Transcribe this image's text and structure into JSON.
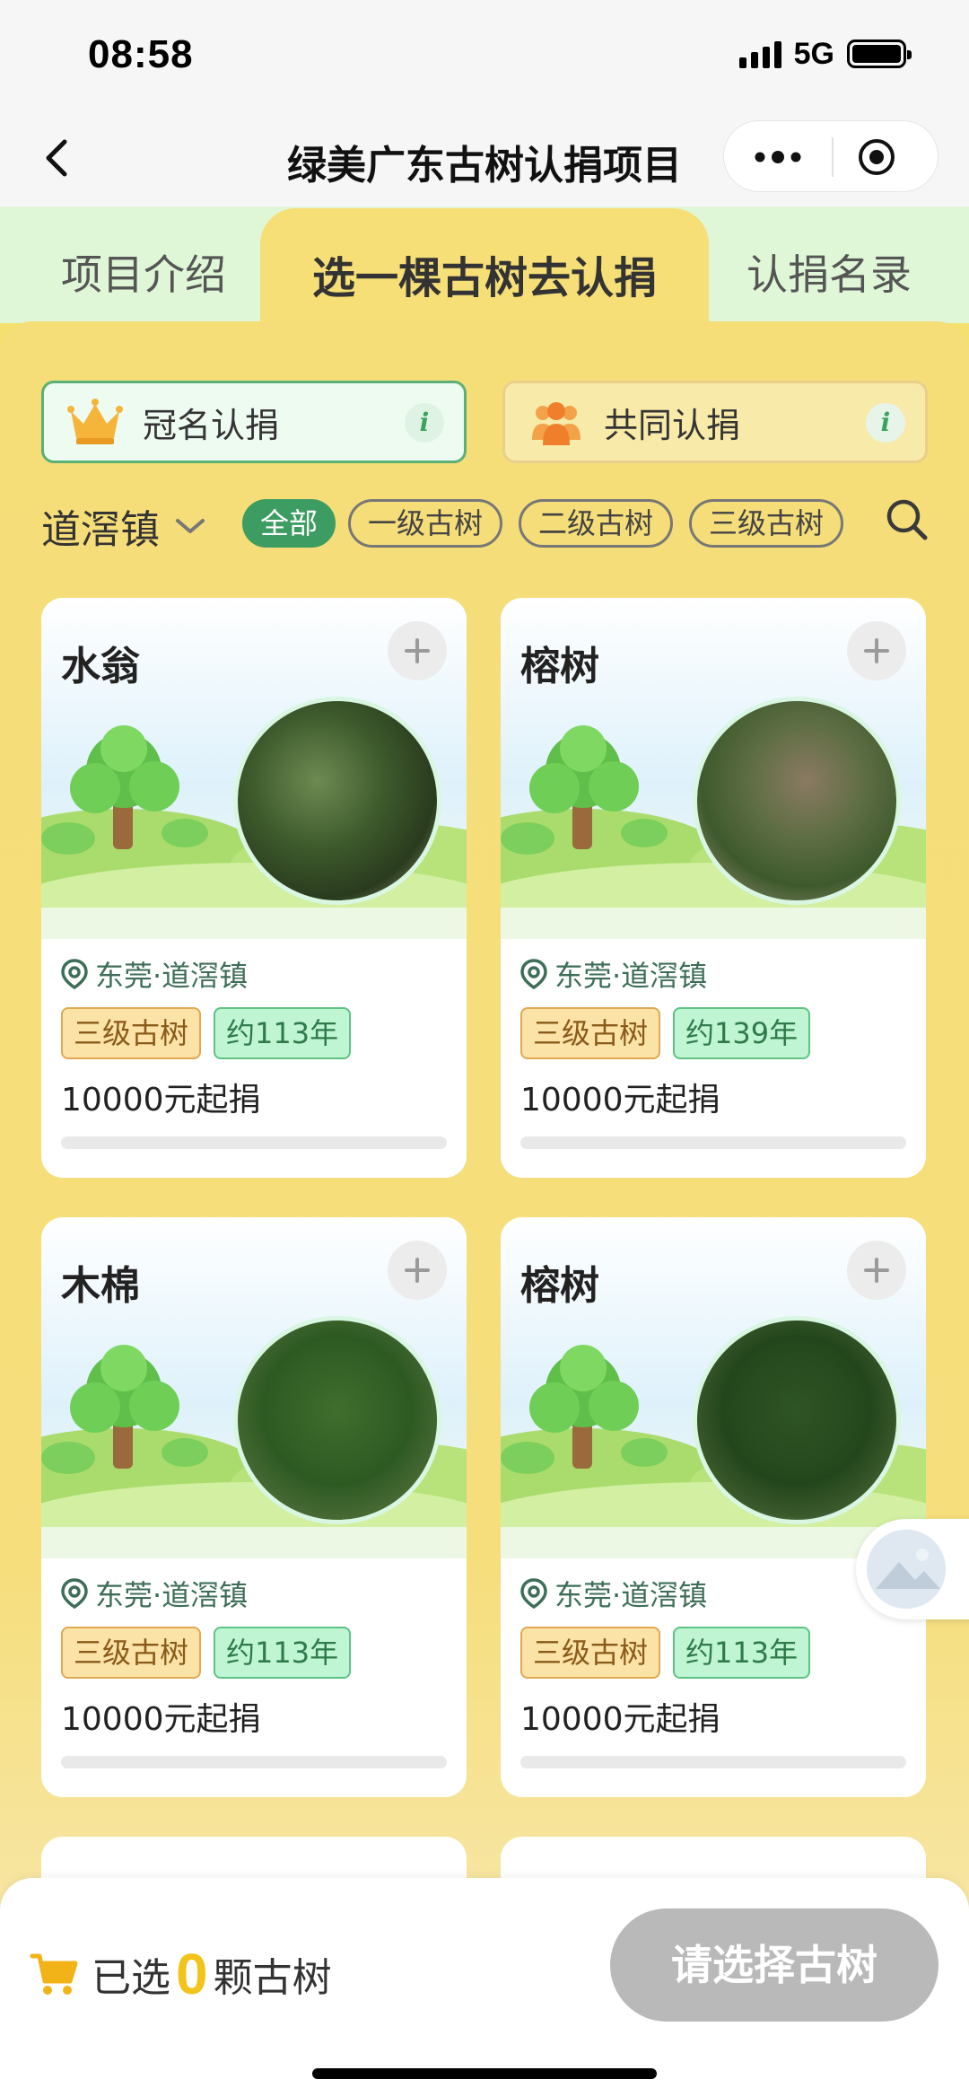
{
  "status_bar": {
    "time": "08:58",
    "network": "5G"
  },
  "nav": {
    "title": "绿美广东古树认捐项目",
    "back_icon": "chevron-left-icon",
    "more_icon": "ellipsis-icon",
    "close_icon": "target-circle-icon"
  },
  "tabs": [
    {
      "label": "项目介绍",
      "active": false
    },
    {
      "label": "选一棵古树去认捐",
      "active": true
    },
    {
      "label": "认捐名录",
      "active": false
    }
  ],
  "modes": {
    "named": {
      "label": "冠名认捐",
      "icon": "crown-icon"
    },
    "joint": {
      "label": "共同认捐",
      "icon": "people-group-icon"
    }
  },
  "filters": {
    "town": "道滘镇",
    "chips": [
      "全部",
      "一级古树",
      "二级古树",
      "三级古树"
    ],
    "active_chip": "全部"
  },
  "trees": [
    {
      "name": "水翁",
      "location": "东莞·道滘镇",
      "level": "三级古树",
      "age": "约113年",
      "price": "10000元起捐",
      "progress": 0
    },
    {
      "name": "榕树",
      "location": "东莞·道滘镇",
      "level": "三级古树",
      "age": "约139年",
      "price": "10000元起捐",
      "progress": 0
    },
    {
      "name": "木棉",
      "location": "东莞·道滘镇",
      "level": "三级古树",
      "age": "约113年",
      "price": "10000元起捐",
      "progress": 0
    },
    {
      "name": "榕树",
      "location": "东莞·道滘镇",
      "level": "三级古树",
      "age": "约113年",
      "price": "10000元起捐",
      "progress": 0
    }
  ],
  "bottom": {
    "selected_prefix": "已选",
    "selected_count": "0",
    "selected_suffix": "颗古树",
    "button_label": "请选择古树"
  },
  "colors": {
    "accent_green": "#3d9c61",
    "panel_yellow": "#f5dd78",
    "count_yellow": "#f2c318",
    "disabled_gray": "#b9b9b9"
  }
}
